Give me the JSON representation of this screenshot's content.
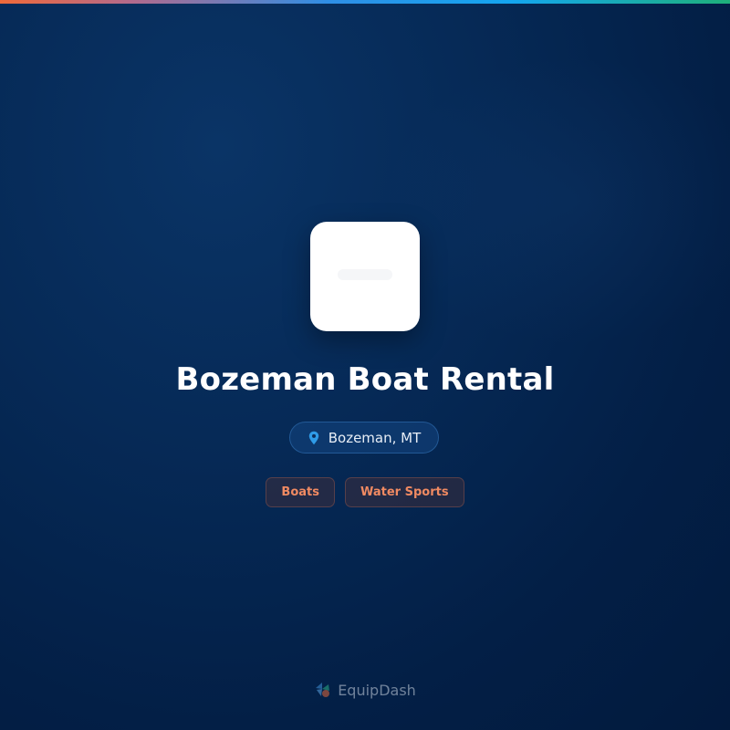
{
  "business": {
    "name": "Bozeman Boat Rental",
    "location": "Bozeman, MT"
  },
  "tags": [
    {
      "label": "Boats"
    },
    {
      "label": "Water Sports"
    }
  ],
  "brand": {
    "name": "EquipDash"
  },
  "icons": {
    "location": "map-pin-icon",
    "brand": "equipdash-logo-icon"
  },
  "colors": {
    "background": "#031f46",
    "tag_text": "#f08a62",
    "pin": "#2f9be8",
    "top_bar_start": "#f06a3a",
    "top_bar_end": "#1fb07a"
  }
}
